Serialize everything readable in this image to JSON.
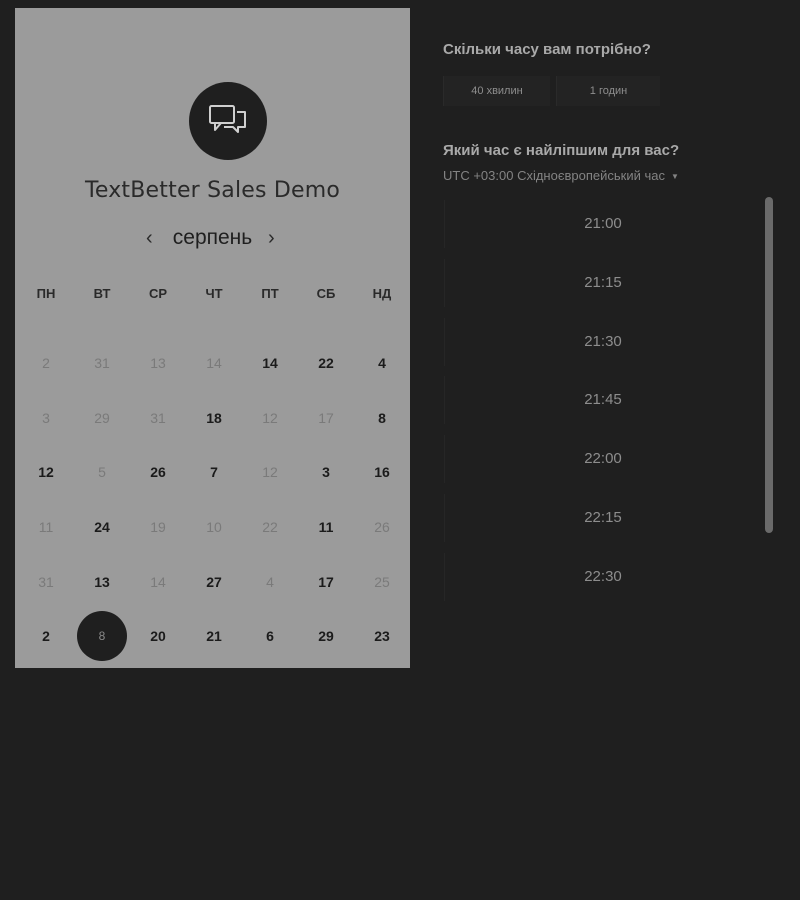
{
  "product": {
    "title": "TextBetter Sales Demo",
    "logo_icon": "chat-bubbles-icon"
  },
  "calendar": {
    "month": "серпень",
    "prev_icon": "‹",
    "next_icon": "›",
    "weekdays": [
      "ПН",
      "ВТ",
      "СР",
      "ЧТ",
      "ПТ",
      "СБ",
      "НД"
    ],
    "days": [
      {
        "label": "2",
        "available": false
      },
      {
        "label": "31",
        "available": false
      },
      {
        "label": "13",
        "available": false
      },
      {
        "label": "14",
        "available": false
      },
      {
        "label": "14",
        "available": true
      },
      {
        "label": "22",
        "available": true
      },
      {
        "label": "4",
        "available": true
      },
      {
        "label": "3",
        "available": false
      },
      {
        "label": "29",
        "available": false
      },
      {
        "label": "31",
        "available": false
      },
      {
        "label": "18",
        "available": true
      },
      {
        "label": "12",
        "available": false
      },
      {
        "label": "17",
        "available": false
      },
      {
        "label": "8",
        "available": true
      },
      {
        "label": "12",
        "available": true
      },
      {
        "label": "5",
        "available": false
      },
      {
        "label": "26",
        "available": true
      },
      {
        "label": "7",
        "available": true
      },
      {
        "label": "12",
        "available": false
      },
      {
        "label": "3",
        "available": true
      },
      {
        "label": "16",
        "available": true
      },
      {
        "label": "11",
        "available": false
      },
      {
        "label": "24",
        "available": true
      },
      {
        "label": "19",
        "available": false
      },
      {
        "label": "10",
        "available": false
      },
      {
        "label": "22",
        "available": false
      },
      {
        "label": "11",
        "available": true
      },
      {
        "label": "26",
        "available": false
      },
      {
        "label": "31",
        "available": false
      },
      {
        "label": "13",
        "available": true
      },
      {
        "label": "14",
        "available": false
      },
      {
        "label": "27",
        "available": true
      },
      {
        "label": "4",
        "available": false
      },
      {
        "label": "17",
        "available": true
      },
      {
        "label": "25",
        "available": false
      },
      {
        "label": "2",
        "available": true
      },
      {
        "label": "8",
        "available": true,
        "selected": true
      },
      {
        "label": "20",
        "available": true
      },
      {
        "label": "21",
        "available": true
      },
      {
        "label": "6",
        "available": true
      },
      {
        "label": "29",
        "available": true
      },
      {
        "label": "23",
        "available": true
      }
    ]
  },
  "duration": {
    "heading": "Скільки часу вам потрібно?",
    "options": [
      "40 хвилин",
      "1 годин"
    ]
  },
  "time": {
    "heading": "Який час є найліпшим для вас?",
    "timezone": "UTC +03:00 Східноєвропейський час",
    "timezone_caret": "▼",
    "slots": [
      "21:00",
      "21:15",
      "21:30",
      "21:45",
      "22:00",
      "22:15",
      "22:30"
    ]
  }
}
